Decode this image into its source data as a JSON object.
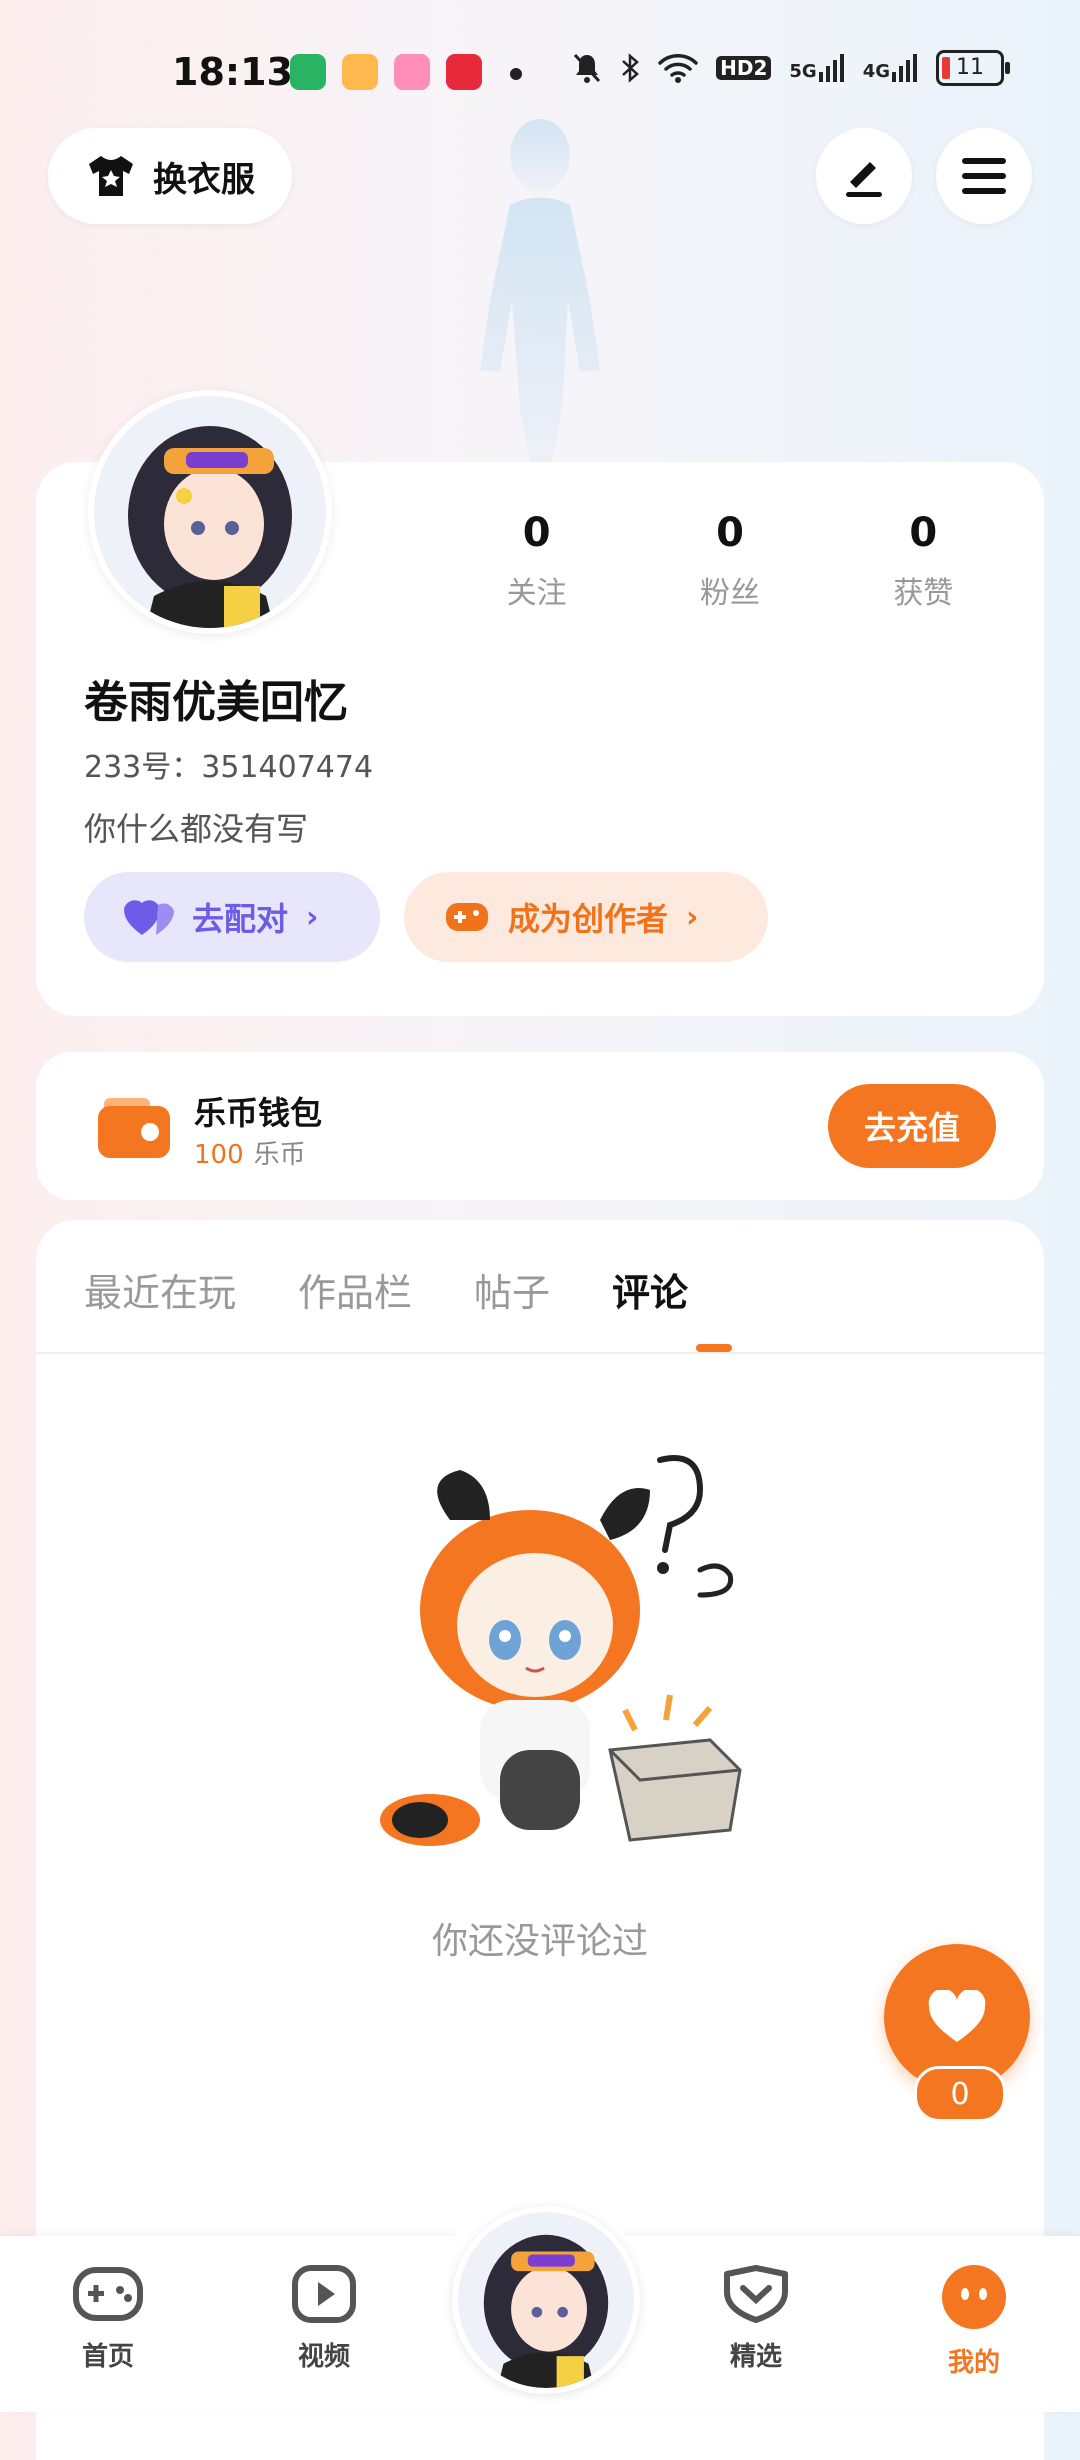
{
  "status_bar": {
    "time": "18:13",
    "network_labels": [
      "HD2",
      "5G",
      "4G"
    ],
    "battery": "11",
    "colors": {
      "battery_low": "#e53935"
    }
  },
  "header": {
    "dress_up_label": "换衣服",
    "icons": [
      "shirt-icon",
      "edit-icon",
      "menu-icon"
    ]
  },
  "profile": {
    "stats": [
      {
        "value": "0",
        "label": "关注"
      },
      {
        "value": "0",
        "label": "粉丝"
      },
      {
        "value": "0",
        "label": "获赞"
      }
    ],
    "nickname": "卷雨优美回忆",
    "uid": "233号：351407474",
    "bio": "你什么都没有写",
    "match_button": "去配对",
    "creator_button": "成为创作者"
  },
  "wallet": {
    "title": "乐币钱包",
    "amount": "100",
    "unit": "乐币",
    "recharge": "去充值"
  },
  "tabs": {
    "items": [
      "最近在玩",
      "作品栏",
      "帖子",
      "评论"
    ],
    "active": "评论"
  },
  "empty_state": {
    "text": "你还没评论过"
  },
  "fab": {
    "count": "0"
  },
  "bottom_nav": {
    "items": [
      {
        "label": "首页",
        "icon": "gamepad-icon"
      },
      {
        "label": "视频",
        "icon": "play-icon"
      },
      {
        "label": "精选",
        "icon": "heart-shield-icon"
      },
      {
        "label": "我的",
        "icon": "face-icon"
      }
    ],
    "active": "我的"
  },
  "colors": {
    "accent": "#f47621",
    "match_bg": "#e7e6fb",
    "match_text": "#6c5ce7",
    "creator_bg": "#fde9dd"
  }
}
